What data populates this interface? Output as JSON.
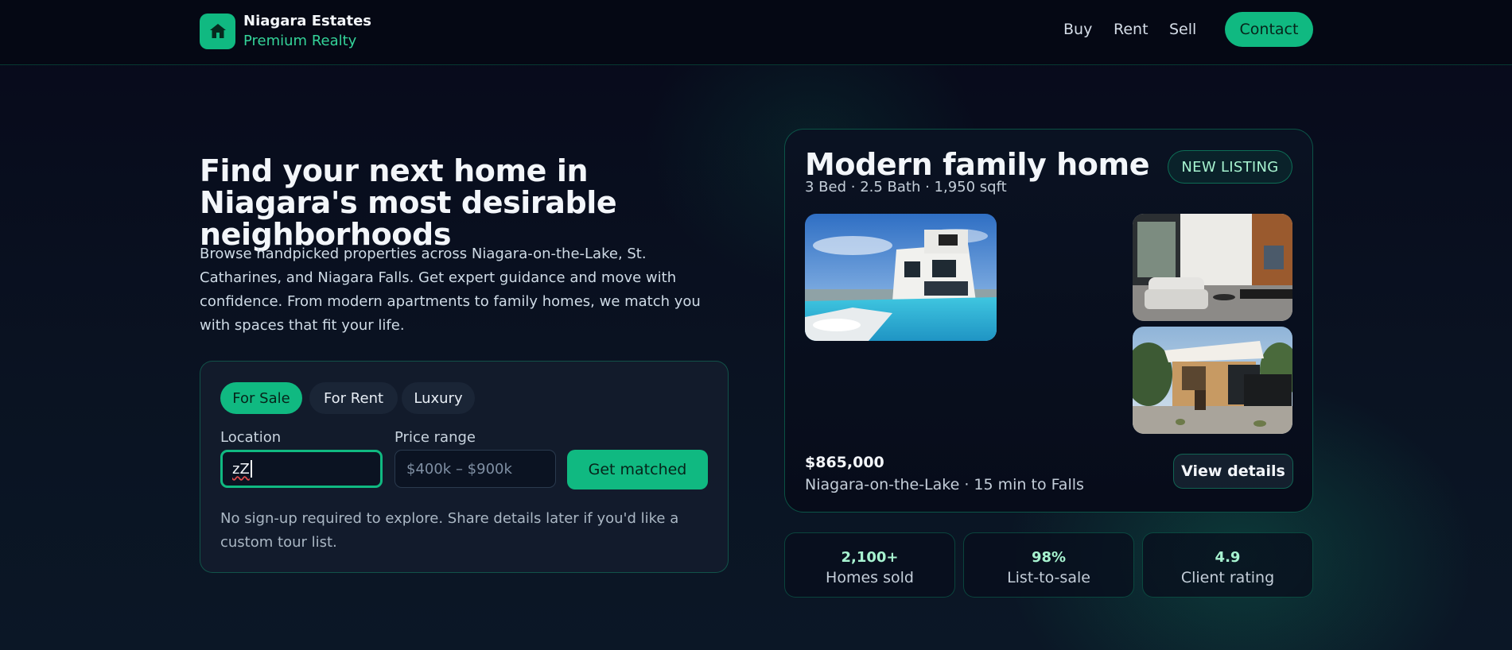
{
  "brand": {
    "name": "Niagara Estates",
    "tagline": "Premium Realty",
    "logo_icon": "home-icon"
  },
  "nav": {
    "links": [
      "Buy",
      "Rent",
      "Sell"
    ],
    "cta": "Contact"
  },
  "hero": {
    "title": "Find your next home in Niagara's most desirable neighborhoods",
    "description": "Browse handpicked properties across Niagara-on-the-Lake, St. Catharines, and Niagara Falls. Get expert guidance and move with confidence. From modern apartments to family homes, we match you with spaces that fit your life."
  },
  "search": {
    "tabs": [
      {
        "label": "For Sale",
        "active": true
      },
      {
        "label": "For Rent",
        "active": false
      },
      {
        "label": "Luxury",
        "active": false
      }
    ],
    "location": {
      "label": "Location",
      "value": "zZ"
    },
    "price": {
      "label": "Price range",
      "placeholder": "$400k – $900k"
    },
    "submit": "Get matched",
    "note": "No sign-up required to explore. Share details later if you'd like a custom tour list."
  },
  "listing": {
    "title": "Modern family home",
    "meta": "3 Bed · 2.5 Bath · 1,950 sqft",
    "badge": "NEW LISTING",
    "price": "$865,000",
    "location": "Niagara-on-the-Lake · 15 min to Falls",
    "details_button": "View details",
    "photos": [
      "pool-villa-photo",
      "living-room-photo",
      "house-exterior-photo"
    ]
  },
  "stats": [
    {
      "value": "2,100+",
      "label": "Homes sold"
    },
    {
      "value": "98%",
      "label": "List-to-sale"
    },
    {
      "value": "4.9",
      "label": "Client rating"
    }
  ],
  "colors": {
    "accent": "#10b981",
    "background": "#07091a",
    "badge_text": "#a7f3d0"
  }
}
